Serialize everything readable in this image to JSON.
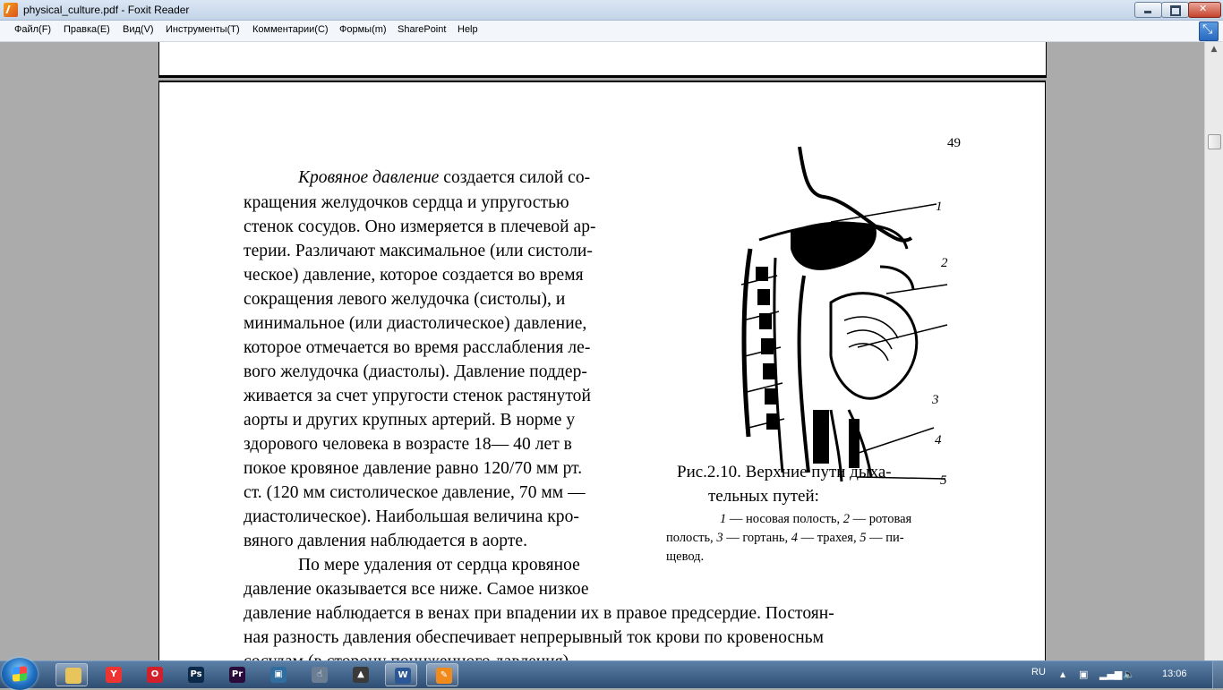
{
  "window": {
    "title": "physical_culture.pdf - Foxit Reader"
  },
  "menu": [
    {
      "label": "Файл(F)",
      "name": "menu-file"
    },
    {
      "label": "Правка(E)",
      "name": "menu-edit"
    },
    {
      "label": "Вид(V)",
      "name": "menu-view"
    },
    {
      "label": "Инструменты(T)",
      "name": "menu-tools"
    },
    {
      "label": "Комментарии(C)",
      "name": "menu-comments"
    },
    {
      "label": "Формы(m)",
      "name": "menu-forms"
    },
    {
      "label": "SharePoint",
      "name": "menu-sharepoint"
    },
    {
      "label": "Help",
      "name": "menu-help"
    }
  ],
  "document": {
    "page_number": "49",
    "paragraph1": {
      "line1_italic": "Кровяное давление",
      "line1_rest": " создается силой со-",
      "lines": [
        "кращения желудочков сердца и упругостью",
        "стенок сосудов. Оно измеряется в плечевой ар-",
        "терии. Различают максимальное (или систоли-",
        "ческое) давление, которое создается во время",
        "сокращения левого желудочка (систолы), и",
        "минимальное (или диастолическое) давление,",
        "которое отмечается во время расслабления ле-",
        "вого желудочка (диастолы). Давление поддер-",
        "живается за счет упругости стенок растянутой",
        "аорты и других крупных артерий. В норме у",
        "здорового человека в возрасте 18— 40 лет в",
        "покое кровяное давление равно 120/70 мм рт.",
        "ст. (120 мм систолическое давление, 70 мм —",
        "диастолическое). Наибольшая величина кро-",
        "вяного давления наблюдается в аорте."
      ]
    },
    "paragraph2": [
      "По мере удаления от сердца кровяное",
      "давление оказывается все ниже. Самое низкое",
      "давление наблюдается в венах при впадении их в правое предсердие. Постоян-",
      "ная разность давления обеспечивает непрерывный ток крови по кровеносньм",
      "сосудам (в сторону пониженного давления)."
    ],
    "figure": {
      "caption_line1": "Рис.2.10. Верхние пути дыха-",
      "caption_line2": "тельных путей:",
      "legend": [
        {
          "n": "1",
          "t": " — носовая полость, "
        },
        {
          "n": "2",
          "t": " — ротовая"
        },
        {
          "n": "",
          "t": "полость, "
        },
        {
          "n": "3",
          "t": " — гортань, "
        },
        {
          "n": "4",
          "t": " — трахея, "
        },
        {
          "n": "5",
          "t": " — пи-"
        },
        {
          "n": "",
          "t": "щевод."
        }
      ],
      "labels": [
        "1",
        "2",
        "3",
        "4",
        "5"
      ]
    }
  },
  "taskbar": {
    "language": "RU",
    "clock": "13:06",
    "apps": [
      {
        "name": "taskbar-explorer",
        "glyph": "",
        "color": "#e8c55a"
      },
      {
        "name": "taskbar-yandex",
        "glyph": "Y",
        "color": "#e33"
      },
      {
        "name": "taskbar-opera",
        "glyph": "O",
        "color": "#d21f2c"
      },
      {
        "name": "taskbar-photoshop",
        "glyph": "Ps",
        "color": "#0b2a4a"
      },
      {
        "name": "taskbar-premiere",
        "glyph": "Pr",
        "color": "#2a0a3a"
      },
      {
        "name": "taskbar-app-blue",
        "glyph": "▣",
        "color": "#2f6e9e"
      },
      {
        "name": "taskbar-app-cursor",
        "glyph": "☝",
        "color": "#6b7e93"
      },
      {
        "name": "taskbar-app-tank",
        "glyph": "▲",
        "color": "#3a3a3a"
      },
      {
        "name": "taskbar-word",
        "glyph": "W",
        "color": "#2b5797"
      },
      {
        "name": "taskbar-foxit",
        "glyph": "✎",
        "color": "#f08a1d"
      }
    ]
  }
}
